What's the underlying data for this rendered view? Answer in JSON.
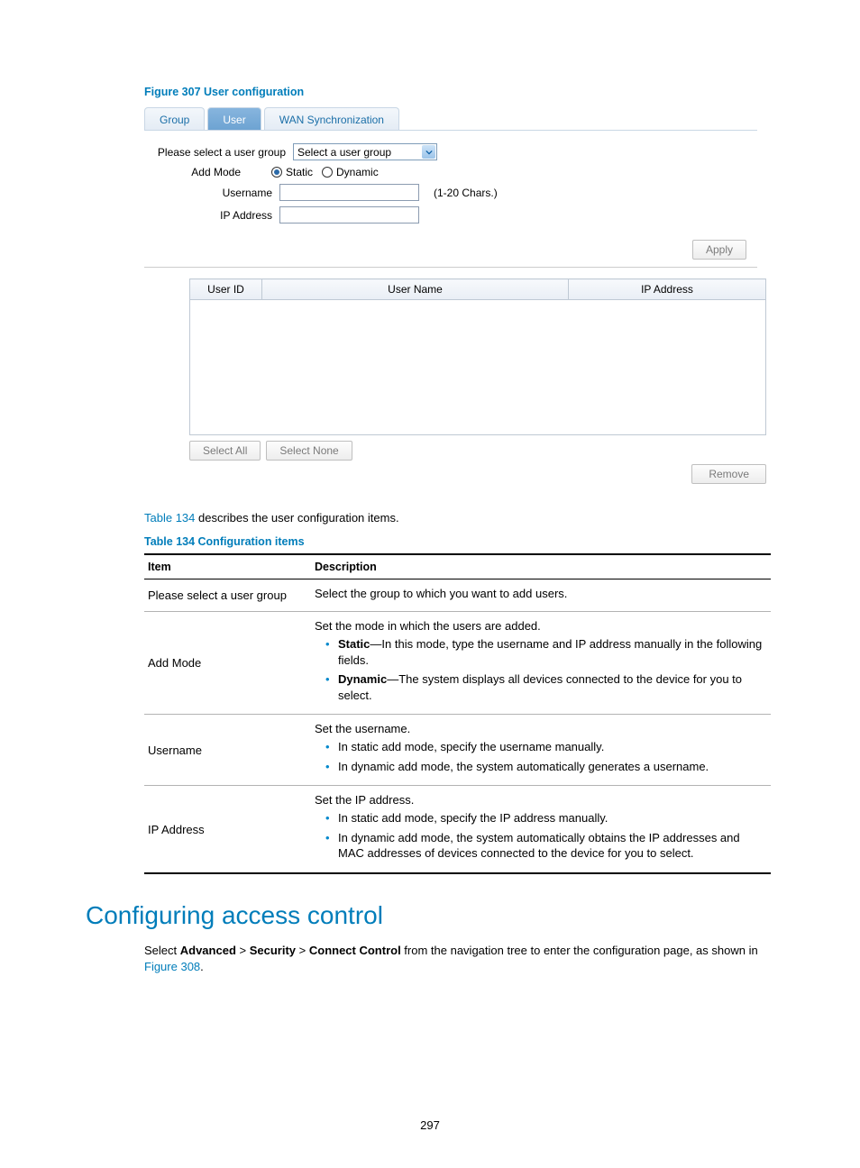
{
  "figure_caption": "Figure 307 User configuration",
  "tabs": {
    "group": "Group",
    "user": "User",
    "wan": "WAN Synchronization"
  },
  "form": {
    "select_group_label": "Please select a user group",
    "select_group_value": "Select a user group",
    "add_mode_label": "Add Mode",
    "radio_static": "Static",
    "radio_dynamic": "Dynamic",
    "username_label": "Username",
    "username_hint": "(1-20 Chars.)",
    "ipaddr_label": "IP Address"
  },
  "buttons": {
    "apply": "Apply",
    "select_all": "Select All",
    "select_none": "Select None",
    "remove": "Remove"
  },
  "datagrid": {
    "col_userid": "User ID",
    "col_username": "User Name",
    "col_ipaddr": "IP Address"
  },
  "intro_line": {
    "xref": "Table 134",
    "rest": " describes the user configuration items."
  },
  "table_caption": "Table 134 Configuration items",
  "doc_table": {
    "headers": {
      "item": "Item",
      "description": "Description"
    },
    "rows": {
      "r1": {
        "item": "Please select a user group",
        "desc_p": "Select the group to which you want to add users."
      },
      "r2": {
        "item": "Add Mode",
        "desc_intro": "Set the mode in which the users are added.",
        "b1_b": "Static",
        "b1_rest": "—In this mode, type the username and IP address manually in the following fields.",
        "b2_b": "Dynamic",
        "b2_rest": "—The system displays all devices connected to the device for you to select."
      },
      "r3": {
        "item": "Username",
        "desc_intro": "Set the username.",
        "b1": "In static add mode, specify the username manually.",
        "b2": "In dynamic add mode, the system automatically generates a username."
      },
      "r4": {
        "item": "IP Address",
        "desc_intro": "Set the IP address.",
        "b1": "In static add mode, specify the IP address manually.",
        "b2": "In dynamic add mode, the system automatically obtains the IP addresses and MAC addresses of devices connected to the device for you to select."
      }
    }
  },
  "section_title": "Configuring access control",
  "body_para": {
    "p1a": "Select ",
    "p1b": "Advanced",
    "p1c": " > ",
    "p1d": "Security",
    "p1e": " > ",
    "p1f": "Connect Control",
    "p1g": " from the navigation tree to enter the configuration page, as shown in ",
    "p1h": "Figure 308",
    "p1i": "."
  },
  "page_number": "297"
}
